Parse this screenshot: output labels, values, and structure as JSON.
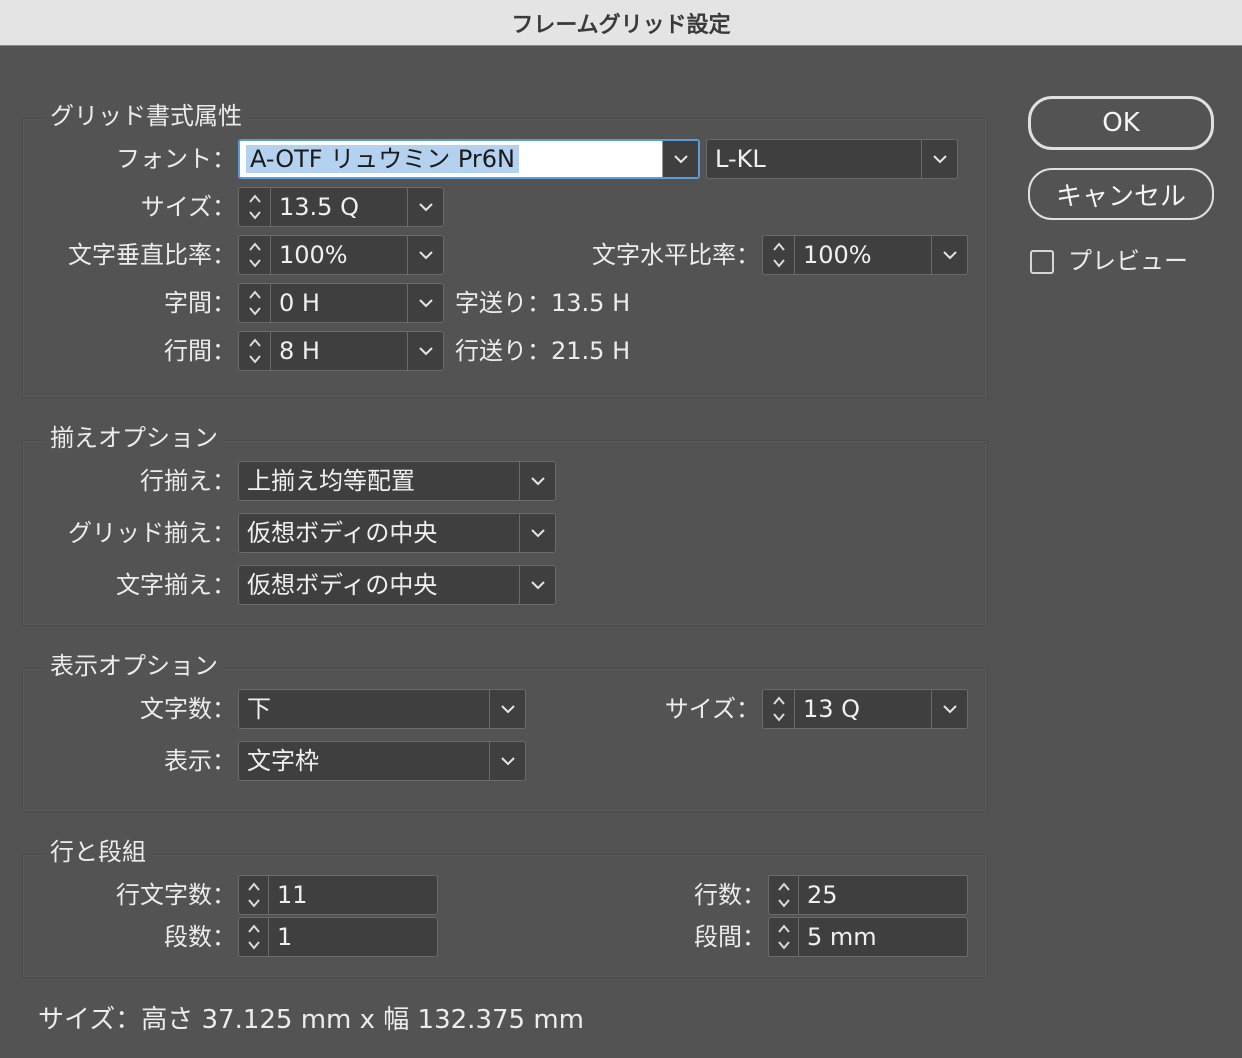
{
  "window": {
    "title": "フレームグリッド設定"
  },
  "buttons": {
    "ok": "OK",
    "cancel": "キャンセル",
    "preview": "プレビュー",
    "preview_checked": false
  },
  "grid_format": {
    "title": "グリッド書式属性",
    "font_label": "フォント：",
    "font_family": "A-OTF リュウミン Pr6N",
    "font_style": "L-KL",
    "size_label": "サイズ：",
    "size_value": "13.5 Q",
    "vscale_label": "文字垂直比率：",
    "vscale_value": "100%",
    "hscale_label": "文字水平比率：",
    "hscale_value": "100%",
    "char_spacing_label": "字間：",
    "char_spacing_value": "0 H",
    "char_advance": "字送り：13.5 H",
    "line_spacing_label": "行間：",
    "line_spacing_value": "8 H",
    "line_advance": "行送り：21.5 H"
  },
  "alignment": {
    "title": "揃えオプション",
    "line_align_label": "行揃え：",
    "line_align_value": "上揃え均等配置",
    "grid_align_label": "グリッド揃え：",
    "grid_align_value": "仮想ボディの中央",
    "char_align_label": "文字揃え：",
    "char_align_value": "仮想ボディの中央"
  },
  "display": {
    "title": "表示オプション",
    "char_count_label": "文字数：",
    "char_count_value": "下",
    "size_label": "サイズ：",
    "size_value": "13 Q",
    "view_label": "表示：",
    "view_value": "文字枠"
  },
  "lines_columns": {
    "title": "行と段組",
    "chars_per_line_label": "行文字数：",
    "chars_per_line_value": "11",
    "lines_label": "行数：",
    "lines_value": "25",
    "columns_label": "段数：",
    "columns_value": "1",
    "gutter_label": "段間：",
    "gutter_value": "5 mm"
  },
  "footer": {
    "size_text": "サイズ：高さ 37.125 mm x 幅 132.375 mm"
  }
}
